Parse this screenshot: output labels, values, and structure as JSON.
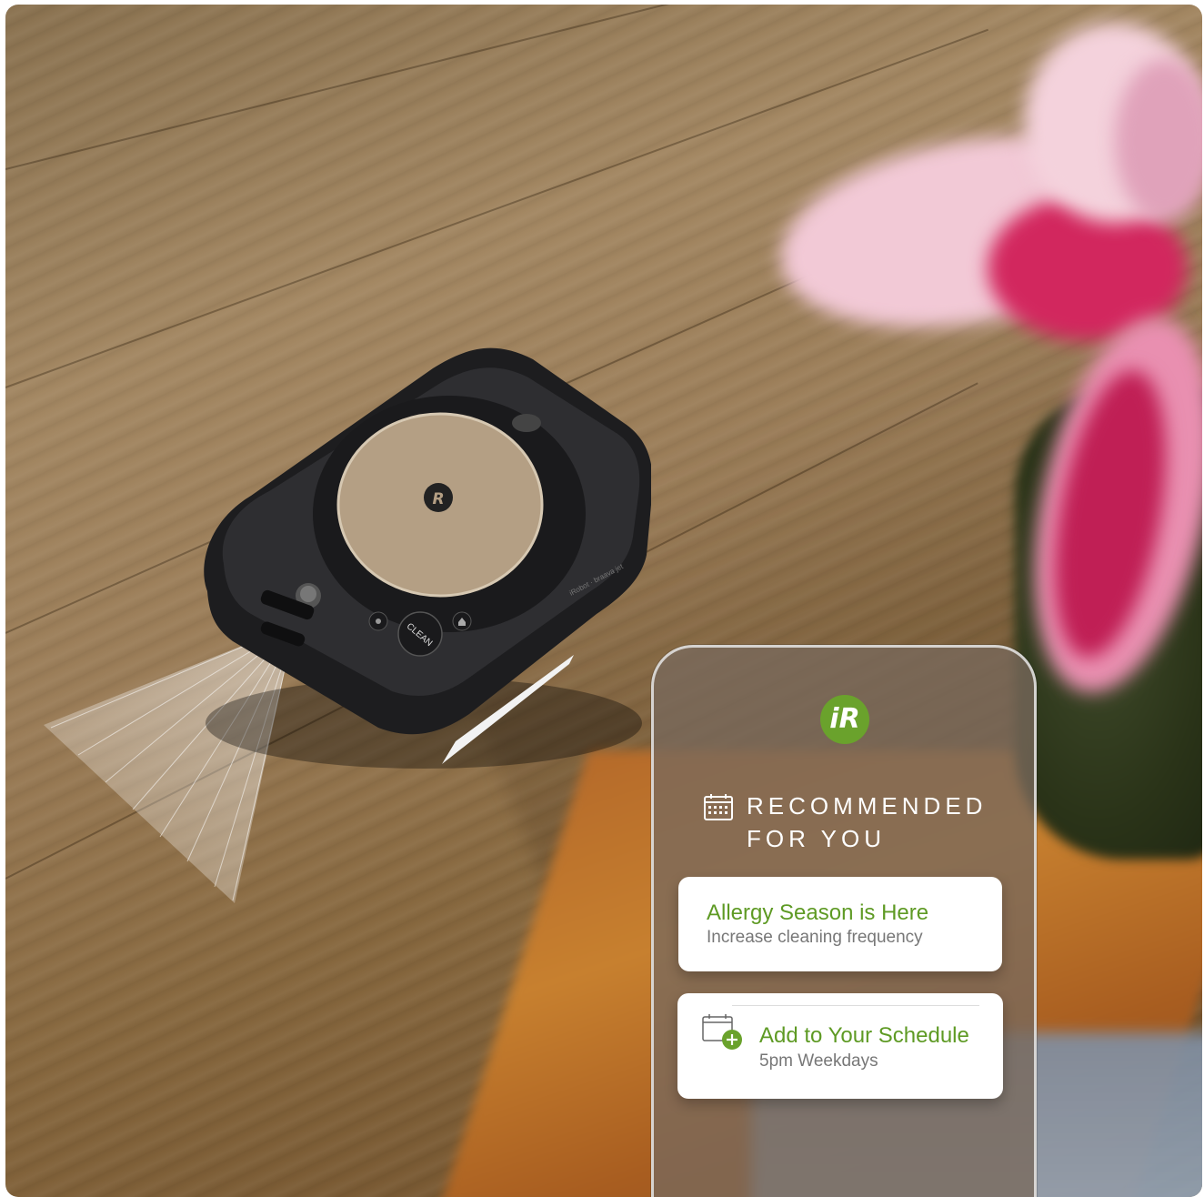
{
  "robot": {
    "button_label": "CLEAN",
    "brand_text": "iRobot · braava jet"
  },
  "app": {
    "logo_text": "iR",
    "recommended_title_line1": "RECOMMENDED",
    "recommended_title_line2": "FOR YOU",
    "cards": [
      {
        "title": "Allergy Season is Here",
        "subtitle": "Increase cleaning frequency"
      },
      {
        "title": "Add to Your Schedule",
        "subtitle": "5pm Weekdays"
      }
    ]
  },
  "colors": {
    "accent_green": "#6aa22c",
    "card_title_green": "#5e9a24",
    "robot_body": "#2b2b2d",
    "robot_lid": "#b49f84"
  },
  "icons": [
    "calendar-icon",
    "calendar-add-icon",
    "irobot-logo-icon",
    "home-icon",
    "spot-clean-icon"
  ]
}
